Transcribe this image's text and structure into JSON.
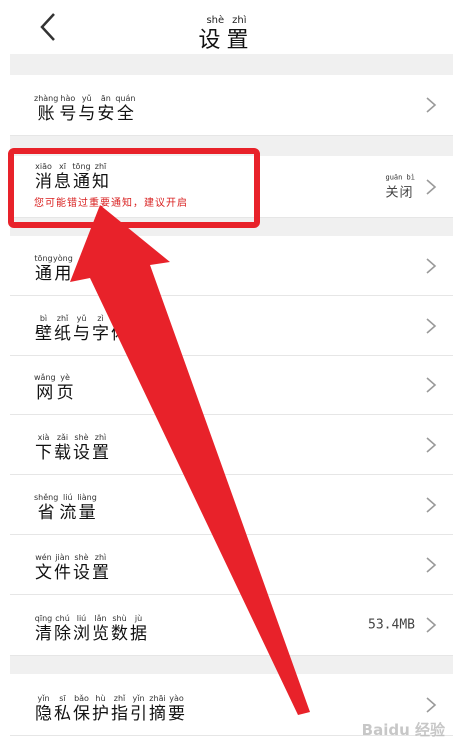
{
  "header": {
    "title_pinyin": [
      "shè",
      "zhì"
    ],
    "title": "设置"
  },
  "rows": [
    {
      "id": "account",
      "pinyin": [
        "zhàng",
        "hào",
        "yǔ",
        "ān",
        "quán"
      ],
      "chars": [
        "账",
        "号",
        "与",
        "安",
        "全"
      ]
    },
    {
      "id": "notification",
      "pinyin": [
        "xiāo",
        "xī",
        "tōng",
        "zhī"
      ],
      "chars": [
        "消",
        "息",
        "通",
        "知"
      ],
      "subtitle": "您可能错过重要通知，建议开启",
      "value_pinyin": "guān bì",
      "value": "关闭"
    },
    {
      "id": "general",
      "pinyin": [
        "tōng",
        "yòng"
      ],
      "chars": [
        "通",
        "用"
      ]
    },
    {
      "id": "wallpaper-font",
      "pinyin": [
        "bì",
        "zhǐ",
        "yǔ",
        "zì",
        ""
      ],
      "chars": [
        "壁",
        "纸",
        "与",
        "字",
        "体"
      ]
    },
    {
      "id": "webpage",
      "pinyin": [
        "wǎng",
        "yè"
      ],
      "chars": [
        "网",
        "页"
      ]
    },
    {
      "id": "download",
      "pinyin": [
        "xià",
        "zǎi",
        "shè",
        "zhì"
      ],
      "chars": [
        "下",
        "载",
        "设",
        "置"
      ]
    },
    {
      "id": "data-saver",
      "pinyin": [
        "shěng",
        "liú",
        "liàng"
      ],
      "chars": [
        "省",
        "流",
        "量"
      ]
    },
    {
      "id": "file",
      "pinyin": [
        "wén",
        "jiàn",
        "shè",
        "zhì"
      ],
      "chars": [
        "文",
        "件",
        "设",
        "置"
      ]
    },
    {
      "id": "clear-data",
      "pinyin": [
        "qīng",
        "chú",
        "liú",
        "lǎn",
        "shù",
        "jù"
      ],
      "chars": [
        "清",
        "除",
        "浏",
        "览",
        "数",
        "据"
      ],
      "value": "53.4MB"
    },
    {
      "id": "privacy",
      "pinyin": [
        "yǐn",
        "sī",
        "bǎo",
        "hù",
        "zhǐ",
        "yǐn",
        "zhāi",
        "yào"
      ],
      "chars": [
        "隐",
        "私",
        "保",
        "护",
        "指",
        "引",
        "摘",
        "要"
      ]
    }
  ],
  "watermark": "Baidu 经验",
  "colors": {
    "highlight": "#e8222a",
    "subtitle": "#d92020",
    "gap": "#f0f0f0"
  }
}
